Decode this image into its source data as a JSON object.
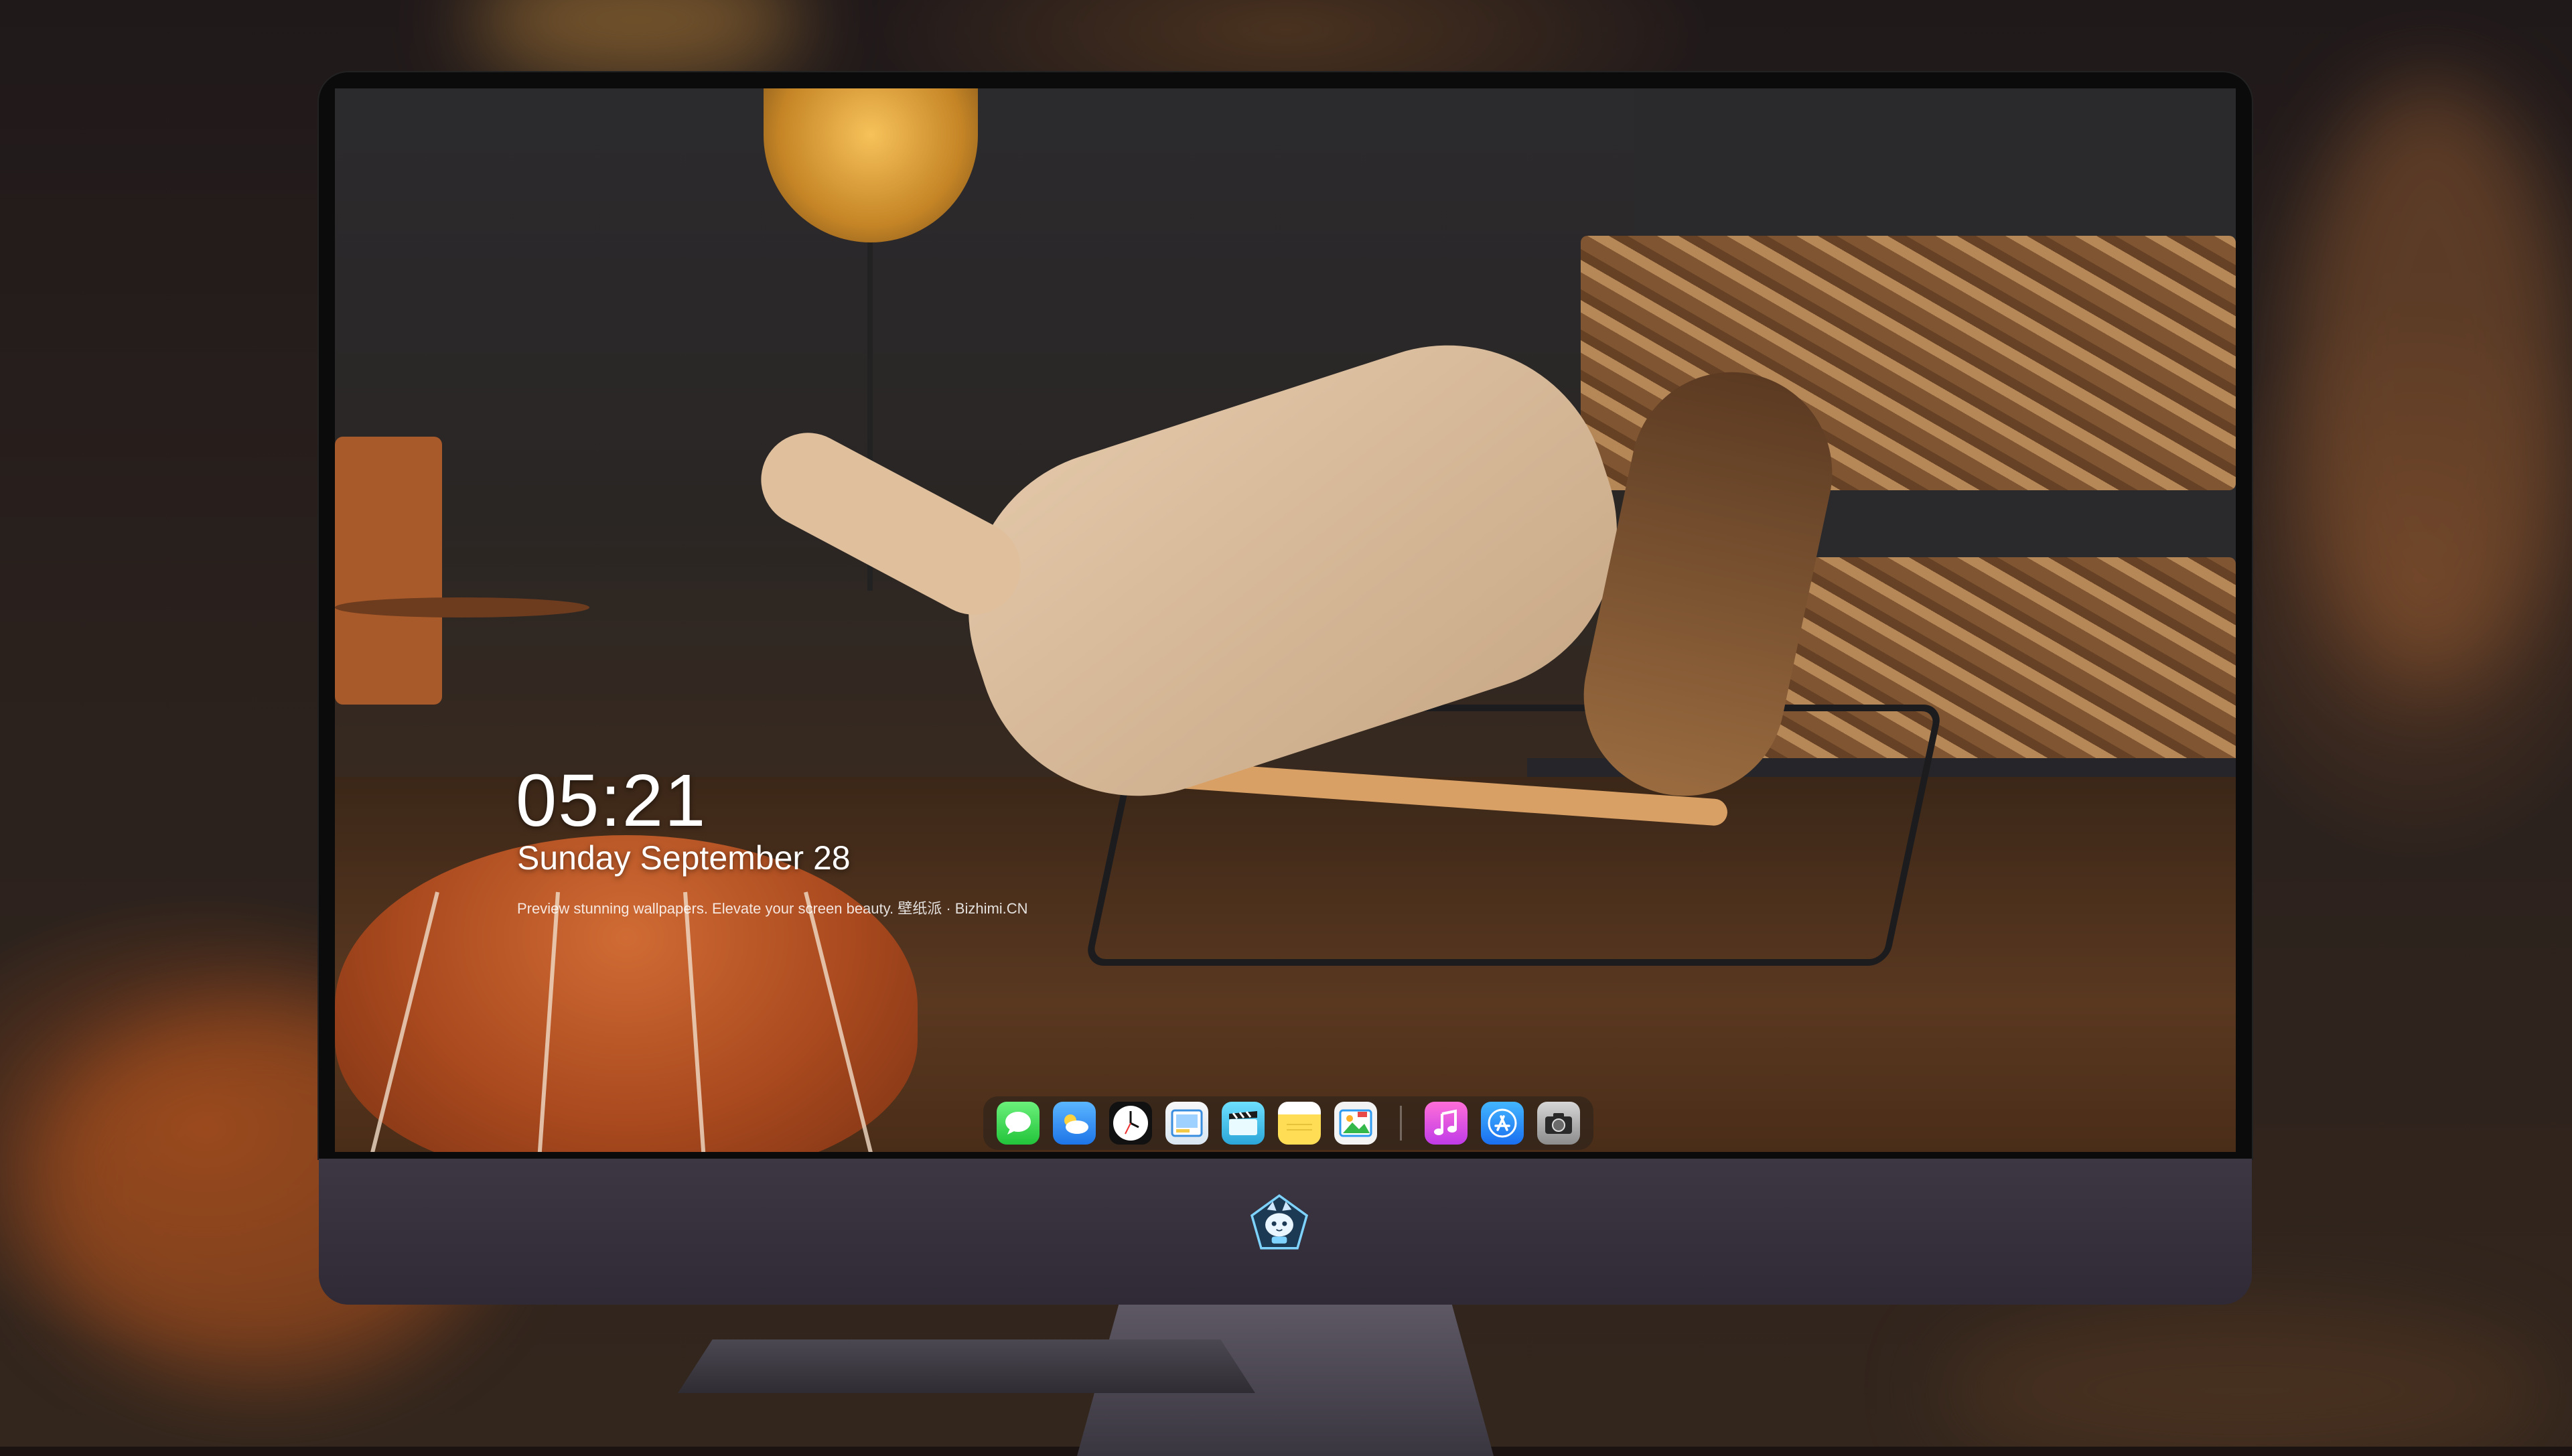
{
  "lock_screen": {
    "time": "05:21",
    "date": "Sunday September  28",
    "tagline": "Preview stunning wallpapers. Elevate your screen beauty. 壁纸派 · Bizhimi.CN"
  },
  "dock": {
    "apps": [
      {
        "name": "Messages",
        "icon": "messages-icon"
      },
      {
        "name": "Weather",
        "icon": "weather-icon"
      },
      {
        "name": "Clock",
        "icon": "clock-icon"
      },
      {
        "name": "Preview",
        "icon": "preview-icon"
      },
      {
        "name": "Claquette",
        "icon": "clapperboard-icon"
      },
      {
        "name": "Notes",
        "icon": "notes-icon"
      },
      {
        "name": "Photos",
        "icon": "photos-icon"
      }
    ],
    "apps_right": [
      {
        "name": "Music",
        "icon": "music-icon"
      },
      {
        "name": "App Store",
        "icon": "app-store-icon"
      },
      {
        "name": "Camera",
        "icon": "camera-icon"
      }
    ]
  },
  "monitor": {
    "brand_logo": "cat-shield-logo"
  },
  "colors": {
    "bezel": "#0b0b0c",
    "chin": "#352f3c",
    "text": "#ffffff"
  }
}
